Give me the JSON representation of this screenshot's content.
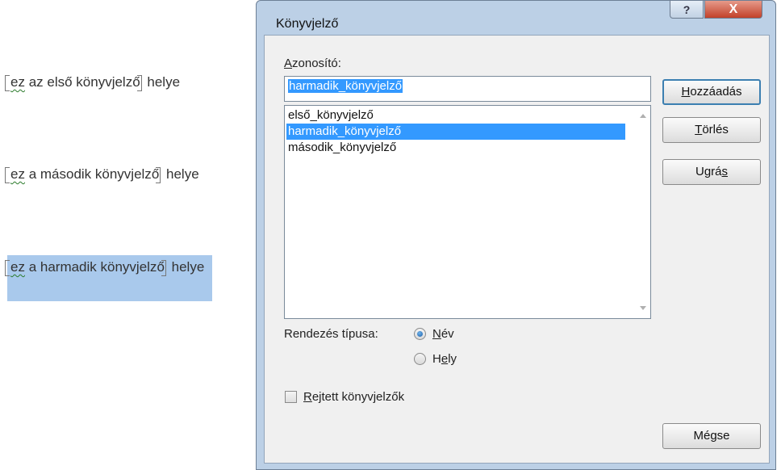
{
  "document": {
    "lines": [
      {
        "pre": "ez",
        "mid": " az első könyvjelz",
        "mid_last": "ő",
        "post": " helye"
      },
      {
        "pre": "ez",
        "mid": " a második könyvjelz",
        "mid_last": "ő",
        "post": " helye"
      },
      {
        "pre": "ez",
        "mid": " a harmadik könyvjelz",
        "mid_last": "ő",
        "post": " helye"
      }
    ]
  },
  "dialog": {
    "title": "Könyvjelző",
    "help_glyph": "?",
    "close_glyph": "X",
    "id_label_first": "A",
    "id_label_rest": "zonosító:",
    "id_value": "harmadik_könyvjelző",
    "list_items": [
      "első_könyvjelző",
      "harmadik_könyvjelző",
      "második_könyvjelző"
    ],
    "selected_index": 1,
    "buttons": {
      "add_first": "H",
      "add_rest": "ozzáadás",
      "delete_first": "T",
      "delete_rest": "örlés",
      "goto_pre": "Ugrá",
      "goto_u": "s",
      "cancel": "Mégse"
    },
    "sort_label": "Rendezés típusa:",
    "sort_options": {
      "name_first": "N",
      "name_rest": "év",
      "place_pre": "H",
      "place_u": "e",
      "place_rest": "ly"
    },
    "sort_selected": "Név",
    "hidden_first": "R",
    "hidden_rest": "ejtett könyvjelzők",
    "hidden_checked": false
  }
}
